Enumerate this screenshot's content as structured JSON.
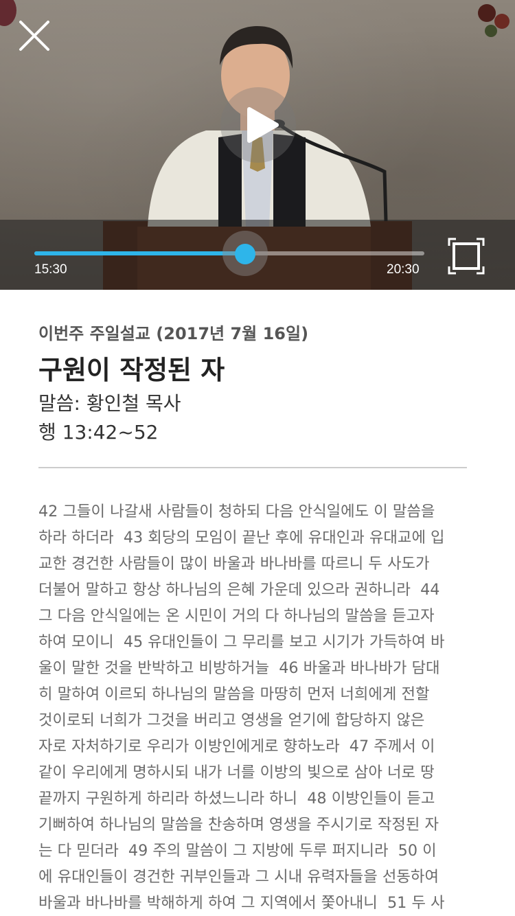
{
  "player": {
    "current_time": "15:30",
    "total_time": "20:30",
    "progress": 0.54,
    "accent_color": "#2eb5ea",
    "icons": {
      "close": "close-icon",
      "play": "play-icon",
      "fullscreen": "fullscreen-icon"
    }
  },
  "sermon": {
    "category": "이번주 주일설교 (2017년 7월 16일)",
    "title": "구원이 작정된 자",
    "preacher": "말씀: 황인철 목사",
    "verse_ref": "행 13:42~52"
  },
  "scripture": {
    "lines": [
      "42 그들이 나갈새 사람들이 청하되 다음 안식일에도 이 말씀을",
      "하라 하더라  43 회당의 모임이 끝난 후에 유대인과 유대교에 입",
      "교한 경건한 사람들이 많이 바울과 바나바를 따르니 두 사도가",
      "더불어 말하고 항상 하나님의 은혜 가운데 있으라 권하니라  44",
      "그 다음 안식일에는 온 시민이 거의 다 하나님의 말씀을 듣고자",
      "하여 모이니  45 유대인들이 그 무리를 보고 시기가 가득하여 바",
      "울이 말한 것을 반박하고 비방하거늘  46 바울과 바나바가 담대",
      "히 말하여 이르되 하나님의 말씀을 마땅히 먼저 너희에게 전할",
      "것이로되 너희가 그것을 버리고 영생을 얻기에 합당하지 않은",
      "자로 자처하기로 우리가 이방인에게로 향하노라  47 주께서 이",
      "같이 우리에게 명하시되 내가 너를 이방의 빛으로 삼아 너로 땅",
      "끝까지 구원하게 하리라 하셨느니라 하니  48 이방인들이 듣고",
      "기뻐하여 하나님의 말씀을 찬송하며 영생을 주시기로 작정된 자",
      "는 다 믿더라  49 주의 말씀이 그 지방에 두루 퍼지니라  50 이",
      "에 유대인들이 경건한 귀부인들과 그 시내 유력자들을 선동하여",
      "바울과 바나바를 박해하게 하여 그 지역에서 쫓아내니  51 두 사"
    ]
  }
}
